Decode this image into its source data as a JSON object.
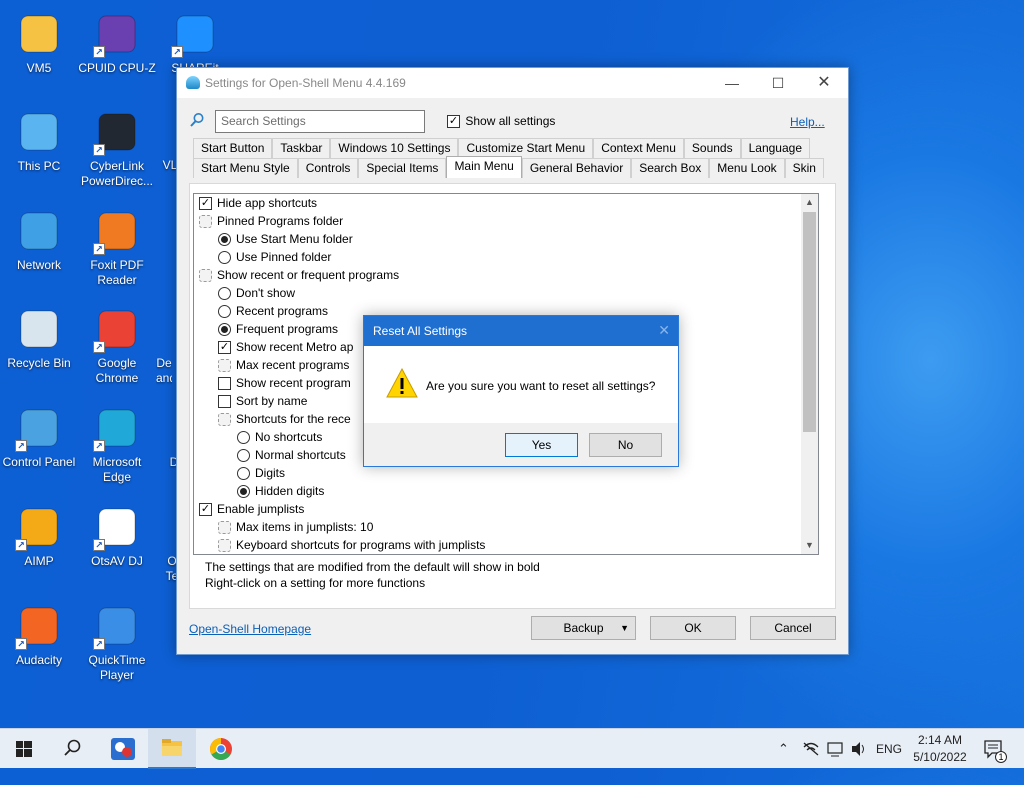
{
  "desktop": {
    "icons": [
      {
        "label": "VM5",
        "icon": "folder-icon",
        "color": "#f5c243"
      },
      {
        "label": "CPUID CPU-Z",
        "icon": "cpuz-icon",
        "color": "#6a3fb0"
      },
      {
        "label": "SHAREit",
        "icon": "shareit-icon",
        "color": "#1e90ff"
      },
      {
        "label": "This PC",
        "icon": "computer-icon",
        "color": "#59b4ef"
      },
      {
        "label": "CyberLink PowerDirec...",
        "icon": "powerdirector-icon",
        "color": "#222831"
      },
      {
        "label": "Network",
        "icon": "network-icon",
        "color": "#3fa0e6"
      },
      {
        "label": "Foxit PDF Reader",
        "icon": "foxit-icon",
        "color": "#f07a21"
      },
      {
        "label": "Recycle Bin",
        "icon": "recycle-bin-icon",
        "color": "#d8e4ee"
      },
      {
        "label": "Google Chrome",
        "icon": "chrome-icon",
        "color": "#ea4335"
      },
      {
        "label": "Control Panel",
        "icon": "control-panel-icon",
        "color": "#4aa3e0"
      },
      {
        "label": "Microsoft Edge",
        "icon": "edge-icon",
        "color": "#1fa8d8"
      },
      {
        "label": "AIMP",
        "icon": "aimp-icon",
        "color": "#f4a916"
      },
      {
        "label": "OtsAV DJ",
        "icon": "document-icon",
        "color": "#ffffff"
      },
      {
        "label": "Audacity",
        "icon": "audacity-icon",
        "color": "#f26522"
      },
      {
        "label": "QuickTime Player",
        "icon": "quicktime-icon",
        "color": "#3a8ee6"
      }
    ],
    "partial_labels": [
      "VL",
      "De and",
      "D",
      "O Te"
    ]
  },
  "window": {
    "title": "Settings for Open-Shell Menu 4.4.169",
    "search_placeholder": "Search Settings",
    "show_all_label": "Show all settings",
    "show_all_checked": true,
    "help_link": "Help...",
    "tabs_row1": [
      "Start Button",
      "Taskbar",
      "Windows 10 Settings",
      "Customize Start Menu",
      "Context Menu",
      "Sounds",
      "Language"
    ],
    "tabs_row2": [
      "Start Menu Style",
      "Controls",
      "Special Items",
      "Main Menu",
      "General Behavior",
      "Search Box",
      "Menu Look",
      "Skin"
    ],
    "active_tab": "Main Menu",
    "tree_items": [
      {
        "label": "Hide app shortcuts",
        "kind": "check",
        "checked": true,
        "indent": 0
      },
      {
        "label": "Pinned Programs folder",
        "kind": "group",
        "indent": 0
      },
      {
        "label": "Use Start Menu folder",
        "kind": "radio",
        "checked": true,
        "indent": 1
      },
      {
        "label": "Use Pinned folder",
        "kind": "radio",
        "checked": false,
        "indent": 1
      },
      {
        "label": "Show recent or frequent programs",
        "kind": "group",
        "indent": 0
      },
      {
        "label": "Don't show",
        "kind": "radio",
        "checked": false,
        "indent": 1
      },
      {
        "label": "Recent programs",
        "kind": "radio",
        "checked": false,
        "indent": 1
      },
      {
        "label": "Frequent programs",
        "kind": "radio",
        "checked": true,
        "indent": 1
      },
      {
        "label": "Show recent Metro ap",
        "kind": "check",
        "checked": true,
        "indent": 1
      },
      {
        "label": "Max recent programs",
        "kind": "group",
        "indent": 1
      },
      {
        "label": "Show recent program",
        "kind": "check",
        "checked": false,
        "indent": 1
      },
      {
        "label": "Sort by name",
        "kind": "check",
        "checked": false,
        "indent": 1
      },
      {
        "label": "Shortcuts for the rece",
        "kind": "group",
        "indent": 1
      },
      {
        "label": "No shortcuts",
        "kind": "radio",
        "checked": false,
        "indent": 2
      },
      {
        "label": "Normal shortcuts",
        "kind": "radio",
        "checked": false,
        "indent": 2
      },
      {
        "label": "Digits",
        "kind": "radio",
        "checked": false,
        "indent": 2
      },
      {
        "label": "Hidden digits",
        "kind": "radio",
        "checked": true,
        "indent": 2
      },
      {
        "label": "Enable jumplists",
        "kind": "check",
        "checked": true,
        "indent": 0
      },
      {
        "label": "Max items in jumplists: 10",
        "kind": "group",
        "indent": 1
      },
      {
        "label": "Keyboard shortcuts for programs with jumplists",
        "kind": "group",
        "indent": 1
      }
    ],
    "note_line1": "The settings that are modified from the default will show in bold",
    "note_line2": "Right-click on a setting for more functions",
    "homepage_link": "Open-Shell Homepage",
    "backup_label": "Backup",
    "ok_label": "OK",
    "cancel_label": "Cancel"
  },
  "dialog": {
    "title": "Reset All Settings",
    "message": "Are you sure you want to reset all settings?",
    "yes_label": "Yes",
    "no_label": "No"
  },
  "taskbar": {
    "language": "ENG",
    "time": "2:14 AM",
    "date": "5/10/2022",
    "notification_count": "1"
  }
}
